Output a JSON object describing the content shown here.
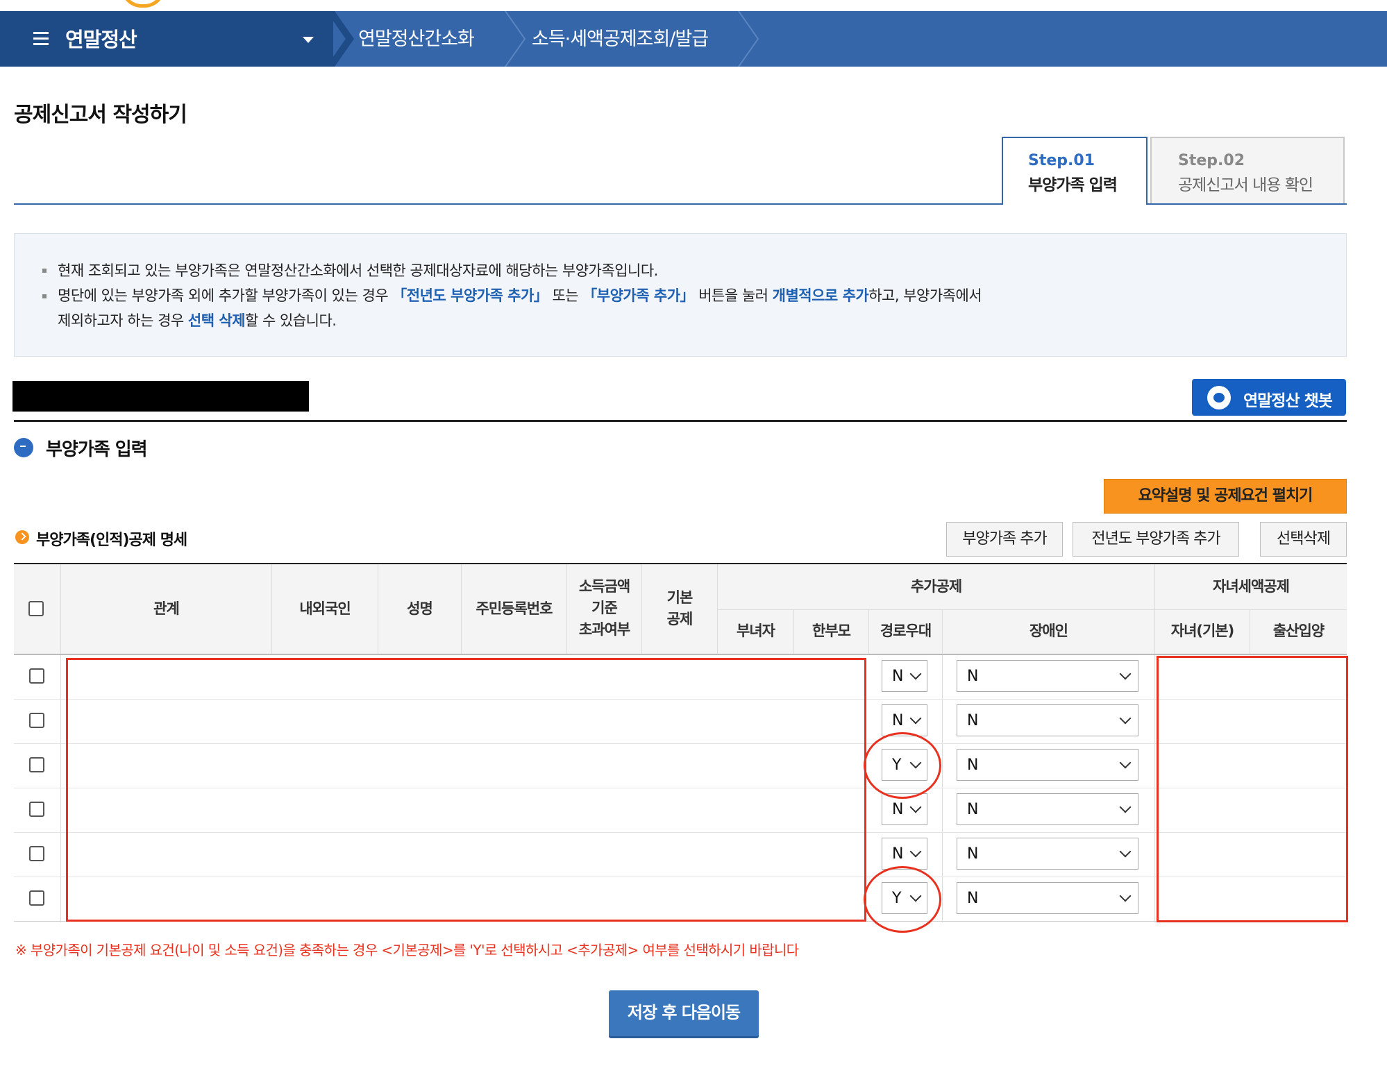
{
  "nav": {
    "menu_title": "연말정산",
    "crumbs": [
      "연말정산간소화",
      "소득·세액공제조회/발급"
    ]
  },
  "page_title": "공제신고서 작성하기",
  "steps": [
    {
      "num": "Step.01",
      "label": "부양가족 입력",
      "active": true
    },
    {
      "num": "Step.02",
      "label": "공제신고서 내용 확인",
      "active": false
    }
  ],
  "notice": {
    "line1": "현재 조회되고 있는 부양가족은 연말정산간소화에서 선택한 공제대상자료에 해당하는 부양가족입니다.",
    "line2": {
      "p1": "명단에 있는 부양가족 외에 추가할 부양가족이 있는 경우 ",
      "h1": "「전년도 부양가족 추가」",
      "p2": " 또는 ",
      "h2": "「부양가족 추가」",
      "p3": " 버튼을 눌러 ",
      "h3": "개별적으로 추가",
      "p4": "하고, 부양가족에서"
    },
    "line3": {
      "p1": "제외하고자 하는 경우 ",
      "h1": "선택 삭제",
      "p2": "할 수 있습니다."
    }
  },
  "chatbot_label": "연말정산 챗봇",
  "section_title": "부양가족 입력",
  "summary_button": "요약설명 및 공제요건 펼치기",
  "sub_title": "부양가족(인적)공제 명세",
  "buttons": {
    "add": "부양가족 추가",
    "add_prev": "전년도 부양가족 추가",
    "delete": "선택삭제"
  },
  "table": {
    "headers": {
      "relation": "관계",
      "nationality": "내외국인",
      "name": "성명",
      "id_number": "주민등록번호",
      "income_l1": "소득금액",
      "income_l2": "기준",
      "income_l3": "초과여부",
      "basic_l1": "기본",
      "basic_l2": "공제",
      "additional": "추가공제",
      "single_woman": "부녀자",
      "single_parent": "한부모",
      "elderly": "경로우대",
      "disabled": "장애인",
      "child_tax": "자녀세액공제",
      "child_basic": "자녀(기본)",
      "birth_adoption": "출산입양"
    },
    "rows": [
      {
        "checked": false,
        "elderly": "N",
        "disabled": "N"
      },
      {
        "checked": false,
        "elderly": "N",
        "disabled": "N"
      },
      {
        "checked": false,
        "elderly": "Y",
        "disabled": "N"
      },
      {
        "checked": false,
        "elderly": "N",
        "disabled": "N"
      },
      {
        "checked": false,
        "elderly": "N",
        "disabled": "N"
      },
      {
        "checked": false,
        "elderly": "Y",
        "disabled": "N"
      }
    ]
  },
  "note": "※  부양가족이 기본공제 요건(나이 및 소득 요건)을 충족하는 경우 <기본공제>를 'Y'로 선택하시고 <추가공제> 여부를 선택하시기 바랍니다",
  "save_button": "저장 후 다음이동"
}
